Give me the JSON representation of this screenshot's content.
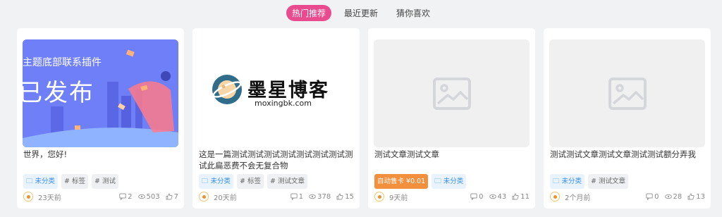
{
  "tabs": [
    {
      "label": "热门推荐",
      "active": true
    },
    {
      "label": "最近更新",
      "active": false
    },
    {
      "label": "猜你喜欢",
      "active": false
    }
  ],
  "posts": [
    {
      "thumb_text_1": "主题底部联系插件",
      "thumb_text_2": "已发布",
      "title": "世界，您好!",
      "tags": [
        {
          "label": "未分类",
          "kind": "category"
        },
        {
          "label": "# 标签",
          "kind": "tag"
        },
        {
          "label": "# 测试",
          "kind": "tag"
        }
      ],
      "time": "23天前",
      "comments": "2",
      "views": "503",
      "likes": "7"
    },
    {
      "logo_title": "墨星博客",
      "logo_subtitle": "moxingbk.com",
      "title": "这是一篇测试测试测试测试测试测试测试测试此扁恶费不会无复合物",
      "tags": [
        {
          "label": "未分类",
          "kind": "category"
        },
        {
          "label": "# 标签",
          "kind": "tag"
        },
        {
          "label": "# 测试文章",
          "kind": "tag"
        }
      ],
      "time": "20天前",
      "comments": "1",
      "views": "378",
      "likes": "15"
    },
    {
      "title": "测试文章测试文章",
      "tags": [
        {
          "label": "自动售卡 ¥0.01",
          "kind": "paid"
        },
        {
          "label": "未分类",
          "kind": "category"
        }
      ],
      "time": "9天前",
      "comments": "0",
      "views": "43",
      "likes": "11"
    },
    {
      "title": "测试测试文章测试文章测试测试额分弄我",
      "tags": [
        {
          "label": "未分类",
          "kind": "category"
        },
        {
          "label": "# 测试文章",
          "kind": "tag"
        }
      ],
      "time": "2个月前",
      "comments": "0",
      "views": "28",
      "likes": "13"
    }
  ],
  "colors": {
    "accent": "#e94b8f",
    "category": "#3a8ee6",
    "paid": "#f3903e",
    "bg": "#f1f2f4"
  }
}
